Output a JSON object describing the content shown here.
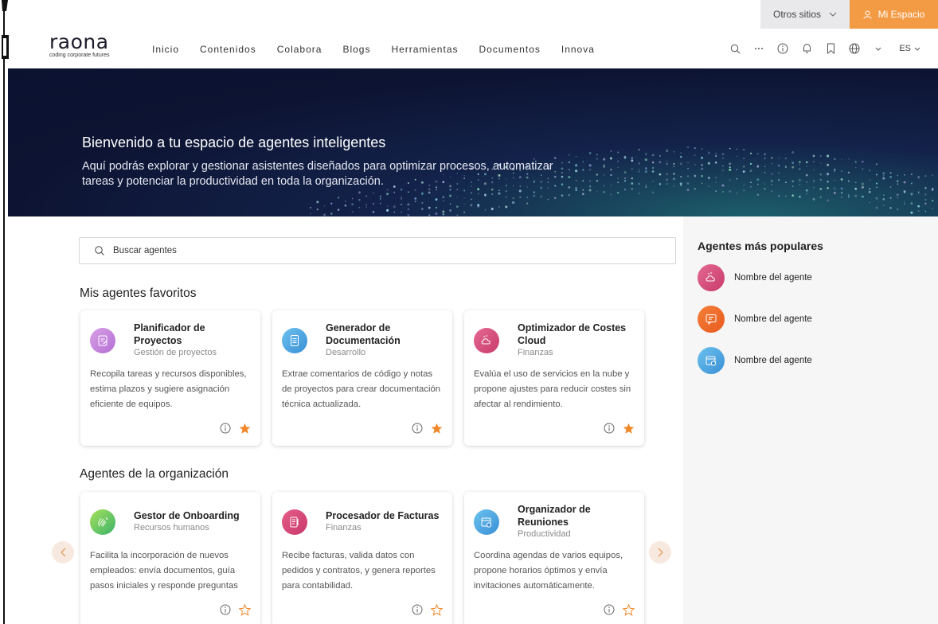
{
  "util": {
    "otros": "Otros sitios",
    "mi_espacio": "Mi Espacio"
  },
  "logo": {
    "word": "raona",
    "tagline": "coding corporate futures"
  },
  "nav": [
    "Inicio",
    "Contenidos",
    "Colabora",
    "Blogs",
    "Herramientas",
    "Documentos",
    "Innova"
  ],
  "tools": {
    "lang": "ES"
  },
  "hero": {
    "title": "Bienvenido a tu espacio de agentes inteligentes",
    "subtitle": "Aquí podrás explorar y gestionar asistentes diseñados para optimizar procesos, automatizar tareas y potenciar la productividad en toda la organización."
  },
  "search": {
    "placeholder": "Buscar agentes"
  },
  "favorites": {
    "title": "Mis agentes favoritos",
    "cards": [
      {
        "title": "Planificador de Proyectos",
        "category": "Gestión de proyectos",
        "description": "Recopila tareas y recursos disponibles, estima plazos y sugiere asignación eficiente de equipos.",
        "icon": "clipboard-edit-icon",
        "starred": true
      },
      {
        "title": "Generador de Documentación",
        "category": "Desarrollo",
        "description": "Extrae comentarios de código y notas de proyectos para crear documentación técnica actualizada.",
        "icon": "document-icon",
        "starred": true
      },
      {
        "title": "Optimizador de Costes Cloud",
        "category": "Finanzas",
        "description": "Evalúa el uso de servicios en la nube y propone ajustes para reducir costes sin afectar al rendimiento.",
        "icon": "cloud-cost-icon",
        "starred": true
      }
    ]
  },
  "organization": {
    "title": "Agentes de la organización",
    "cards": [
      {
        "title": "Gestor de Onboarding",
        "category": "Recursos humanos",
        "description": "Facilita la incorporación de nuevos empleados: envía documentos, guía pasos iniciales y responde preguntas",
        "icon": "wave-hand-icon",
        "starred": false
      },
      {
        "title": "Procesador de Facturas",
        "category": "Finanzas",
        "description": "Recibe facturas, valida datos con pedidos y contratos, y genera reportes para contabilidad.",
        "icon": "invoice-icon",
        "starred": false
      },
      {
        "title": "Organizador de Reuniones",
        "category": "Productividad",
        "description": "Coordina agendas de varios equipos, propone horarios óptimos y envía invitaciones automáticamente.",
        "icon": "calendar-icon",
        "starred": false
      }
    ]
  },
  "popular": {
    "title": "Agentes más populares",
    "items": [
      {
        "label": "Nombre del agente",
        "icon": "cloud-cost-icon"
      },
      {
        "label": "Nombre del agente",
        "icon": "chat-icon"
      },
      {
        "label": "Nombre del agente",
        "icon": "calendar-icon"
      }
    ]
  },
  "colors": {
    "accent": "#f39a45",
    "hero_bg": "#0d1433",
    "star": "#f0892b"
  }
}
